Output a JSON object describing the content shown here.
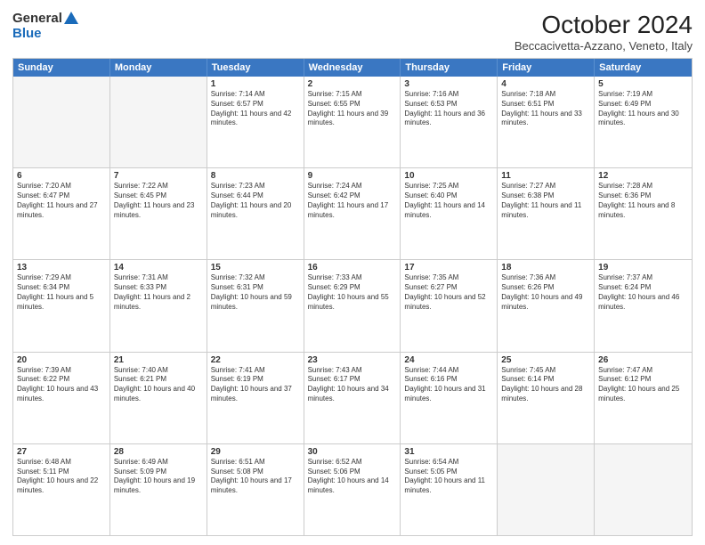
{
  "logo": {
    "general": "General",
    "blue": "Blue"
  },
  "title": "October 2024",
  "subtitle": "Beccacivetta-Azzano, Veneto, Italy",
  "header_days": [
    "Sunday",
    "Monday",
    "Tuesday",
    "Wednesday",
    "Thursday",
    "Friday",
    "Saturday"
  ],
  "weeks": [
    [
      {
        "day": "",
        "empty": true
      },
      {
        "day": "",
        "empty": true
      },
      {
        "day": "1",
        "line1": "Sunrise: 7:14 AM",
        "line2": "Sunset: 6:57 PM",
        "line3": "Daylight: 11 hours and 42 minutes."
      },
      {
        "day": "2",
        "line1": "Sunrise: 7:15 AM",
        "line2": "Sunset: 6:55 PM",
        "line3": "Daylight: 11 hours and 39 minutes."
      },
      {
        "day": "3",
        "line1": "Sunrise: 7:16 AM",
        "line2": "Sunset: 6:53 PM",
        "line3": "Daylight: 11 hours and 36 minutes."
      },
      {
        "day": "4",
        "line1": "Sunrise: 7:18 AM",
        "line2": "Sunset: 6:51 PM",
        "line3": "Daylight: 11 hours and 33 minutes."
      },
      {
        "day": "5",
        "line1": "Sunrise: 7:19 AM",
        "line2": "Sunset: 6:49 PM",
        "line3": "Daylight: 11 hours and 30 minutes."
      }
    ],
    [
      {
        "day": "6",
        "line1": "Sunrise: 7:20 AM",
        "line2": "Sunset: 6:47 PM",
        "line3": "Daylight: 11 hours and 27 minutes."
      },
      {
        "day": "7",
        "line1": "Sunrise: 7:22 AM",
        "line2": "Sunset: 6:45 PM",
        "line3": "Daylight: 11 hours and 23 minutes."
      },
      {
        "day": "8",
        "line1": "Sunrise: 7:23 AM",
        "line2": "Sunset: 6:44 PM",
        "line3": "Daylight: 11 hours and 20 minutes."
      },
      {
        "day": "9",
        "line1": "Sunrise: 7:24 AM",
        "line2": "Sunset: 6:42 PM",
        "line3": "Daylight: 11 hours and 17 minutes."
      },
      {
        "day": "10",
        "line1": "Sunrise: 7:25 AM",
        "line2": "Sunset: 6:40 PM",
        "line3": "Daylight: 11 hours and 14 minutes."
      },
      {
        "day": "11",
        "line1": "Sunrise: 7:27 AM",
        "line2": "Sunset: 6:38 PM",
        "line3": "Daylight: 11 hours and 11 minutes."
      },
      {
        "day": "12",
        "line1": "Sunrise: 7:28 AM",
        "line2": "Sunset: 6:36 PM",
        "line3": "Daylight: 11 hours and 8 minutes."
      }
    ],
    [
      {
        "day": "13",
        "line1": "Sunrise: 7:29 AM",
        "line2": "Sunset: 6:34 PM",
        "line3": "Daylight: 11 hours and 5 minutes."
      },
      {
        "day": "14",
        "line1": "Sunrise: 7:31 AM",
        "line2": "Sunset: 6:33 PM",
        "line3": "Daylight: 11 hours and 2 minutes."
      },
      {
        "day": "15",
        "line1": "Sunrise: 7:32 AM",
        "line2": "Sunset: 6:31 PM",
        "line3": "Daylight: 10 hours and 59 minutes."
      },
      {
        "day": "16",
        "line1": "Sunrise: 7:33 AM",
        "line2": "Sunset: 6:29 PM",
        "line3": "Daylight: 10 hours and 55 minutes."
      },
      {
        "day": "17",
        "line1": "Sunrise: 7:35 AM",
        "line2": "Sunset: 6:27 PM",
        "line3": "Daylight: 10 hours and 52 minutes."
      },
      {
        "day": "18",
        "line1": "Sunrise: 7:36 AM",
        "line2": "Sunset: 6:26 PM",
        "line3": "Daylight: 10 hours and 49 minutes."
      },
      {
        "day": "19",
        "line1": "Sunrise: 7:37 AM",
        "line2": "Sunset: 6:24 PM",
        "line3": "Daylight: 10 hours and 46 minutes."
      }
    ],
    [
      {
        "day": "20",
        "line1": "Sunrise: 7:39 AM",
        "line2": "Sunset: 6:22 PM",
        "line3": "Daylight: 10 hours and 43 minutes."
      },
      {
        "day": "21",
        "line1": "Sunrise: 7:40 AM",
        "line2": "Sunset: 6:21 PM",
        "line3": "Daylight: 10 hours and 40 minutes."
      },
      {
        "day": "22",
        "line1": "Sunrise: 7:41 AM",
        "line2": "Sunset: 6:19 PM",
        "line3": "Daylight: 10 hours and 37 minutes."
      },
      {
        "day": "23",
        "line1": "Sunrise: 7:43 AM",
        "line2": "Sunset: 6:17 PM",
        "line3": "Daylight: 10 hours and 34 minutes."
      },
      {
        "day": "24",
        "line1": "Sunrise: 7:44 AM",
        "line2": "Sunset: 6:16 PM",
        "line3": "Daylight: 10 hours and 31 minutes."
      },
      {
        "day": "25",
        "line1": "Sunrise: 7:45 AM",
        "line2": "Sunset: 6:14 PM",
        "line3": "Daylight: 10 hours and 28 minutes."
      },
      {
        "day": "26",
        "line1": "Sunrise: 7:47 AM",
        "line2": "Sunset: 6:12 PM",
        "line3": "Daylight: 10 hours and 25 minutes."
      }
    ],
    [
      {
        "day": "27",
        "line1": "Sunrise: 6:48 AM",
        "line2": "Sunset: 5:11 PM",
        "line3": "Daylight: 10 hours and 22 minutes."
      },
      {
        "day": "28",
        "line1": "Sunrise: 6:49 AM",
        "line2": "Sunset: 5:09 PM",
        "line3": "Daylight: 10 hours and 19 minutes."
      },
      {
        "day": "29",
        "line1": "Sunrise: 6:51 AM",
        "line2": "Sunset: 5:08 PM",
        "line3": "Daylight: 10 hours and 17 minutes."
      },
      {
        "day": "30",
        "line1": "Sunrise: 6:52 AM",
        "line2": "Sunset: 5:06 PM",
        "line3": "Daylight: 10 hours and 14 minutes."
      },
      {
        "day": "31",
        "line1": "Sunrise: 6:54 AM",
        "line2": "Sunset: 5:05 PM",
        "line3": "Daylight: 10 hours and 11 minutes."
      },
      {
        "day": "",
        "empty": true
      },
      {
        "day": "",
        "empty": true
      }
    ]
  ]
}
